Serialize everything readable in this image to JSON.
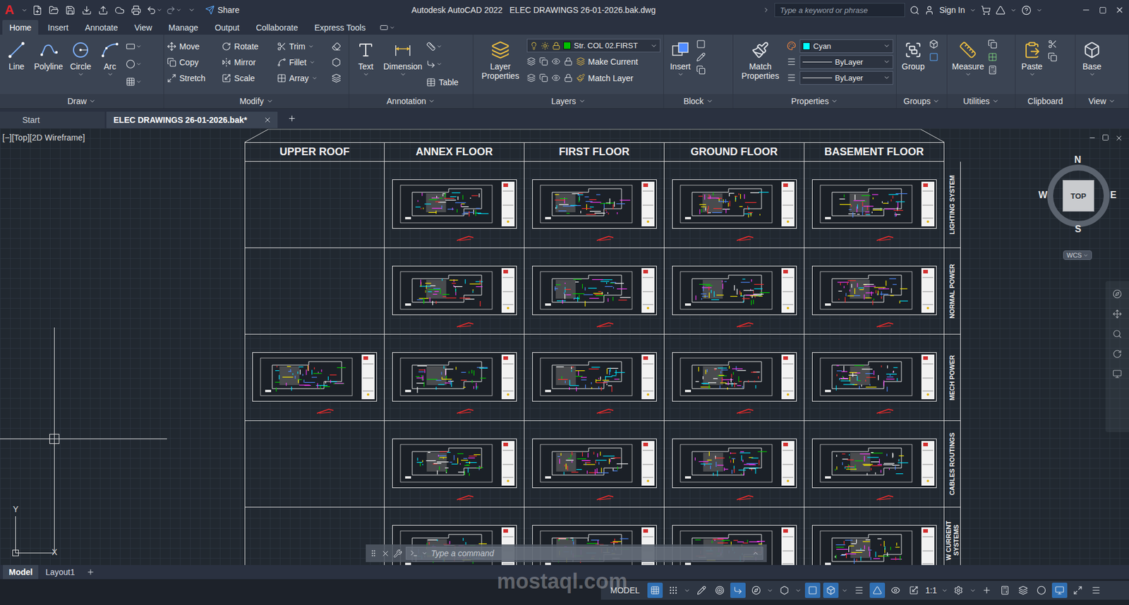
{
  "window": {
    "app_logo": "A",
    "title": "Autodesk AutoCAD 2022",
    "file": "ELEC DRAWINGS 26-01-2026.bak.dwg"
  },
  "quick_access": {
    "share": "Share"
  },
  "search": {
    "placeholder": "Type a keyword or phrase"
  },
  "account": {
    "sign_in": "Sign In"
  },
  "ribbon_tabs": [
    {
      "label": "Home",
      "selected": true
    },
    {
      "label": "Insert",
      "selected": false
    },
    {
      "label": "Annotate",
      "selected": false
    },
    {
      "label": "View",
      "selected": false
    },
    {
      "label": "Manage",
      "selected": false
    },
    {
      "label": "Output",
      "selected": false
    },
    {
      "label": "Collaborate",
      "selected": false
    },
    {
      "label": "Express Tools",
      "selected": false
    }
  ],
  "ribbon": {
    "draw": {
      "title": "Draw",
      "tools": [
        {
          "label": "Line",
          "kind": "line",
          "menu": false
        },
        {
          "label": "Polyline",
          "kind": "polyline",
          "menu": false
        },
        {
          "label": "Circle",
          "kind": "circle",
          "menu": true
        },
        {
          "label": "Arc",
          "kind": "arc",
          "menu": true
        }
      ]
    },
    "modify": {
      "title": "Modify",
      "tools": [
        {
          "label": "Move",
          "kind": "move",
          "menu": false
        },
        {
          "label": "Rotate",
          "kind": "rotate",
          "menu": false
        },
        {
          "label": "Trim",
          "kind": "trim",
          "menu": true
        },
        {
          "label": "Copy",
          "kind": "copy",
          "menu": false
        },
        {
          "label": "Mirror",
          "kind": "mirror",
          "menu": false
        },
        {
          "label": "Fillet",
          "kind": "fillet",
          "menu": true
        },
        {
          "label": "Stretch",
          "kind": "stretch",
          "menu": false
        },
        {
          "label": "Scale",
          "kind": "scale",
          "menu": false
        },
        {
          "label": "Array",
          "kind": "array",
          "menu": true
        }
      ]
    },
    "annotation": {
      "title": "Annotation",
      "tools": [
        {
          "label": "Text",
          "kind": "text",
          "menu": true
        },
        {
          "label": "Dimension",
          "kind": "dimension",
          "menu": true
        }
      ],
      "table": "Table"
    },
    "layers": {
      "title": "Layers",
      "properties": "Layer Properties",
      "current_layer": {
        "label": "Str. COL 02.FIRST",
        "color": "#00c000"
      },
      "actions": [
        "Make Current",
        "Match Layer"
      ]
    },
    "block": {
      "title": "Block",
      "insert": "Insert"
    },
    "properties": {
      "title": "Properties",
      "match": "Match Properties",
      "color": {
        "label": "Cyan",
        "color": "#00ffff"
      },
      "linetype": "ByLayer",
      "lineweight": "ByLayer"
    },
    "groups": {
      "title": "Groups",
      "tool": "Group"
    },
    "utilities": {
      "title": "Utilities",
      "tool": "Measure"
    },
    "clipboard": {
      "title": "Clipboard",
      "tool": "Paste"
    },
    "view": {
      "title": "View",
      "tool": "Base"
    }
  },
  "file_tabs": [
    {
      "label": "Start",
      "selected": false,
      "closable": false
    },
    {
      "label": "ELEC DRAWINGS 26-01-2026.bak*",
      "selected": true,
      "closable": true
    }
  ],
  "viewport": {
    "label": "[−][Top][2D Wireframe]",
    "viewcube": {
      "north": "N",
      "south": "S",
      "east": "E",
      "west": "W",
      "face": "TOP",
      "ucs": "WCS"
    },
    "ucs_icon": {
      "y": "Y",
      "x": "X"
    }
  },
  "sheet_index": {
    "columns": [
      "UPPER ROOF",
      "ANNEX FLOOR",
      "FIRST FLOOR",
      "GROUND FLOOR",
      "BASEMENT FLOOR"
    ],
    "rows": [
      {
        "label": "LIGHTING SYSTEM",
        "sheets": [
          false,
          true,
          true,
          true,
          true
        ]
      },
      {
        "label": "NORMAL POWER",
        "sheets": [
          false,
          true,
          true,
          true,
          true
        ]
      },
      {
        "label": "MECH POWER",
        "sheets": [
          true,
          true,
          true,
          true,
          true
        ]
      },
      {
        "label": "CABLES ROUTINGS",
        "sheets": [
          false,
          true,
          true,
          true,
          true
        ]
      },
      {
        "label": "W CURRENT SYSTEMS",
        "sheets": [
          false,
          true,
          true,
          true,
          true
        ]
      }
    ]
  },
  "command_line": {
    "placeholder": "Type a command"
  },
  "layout_tabs": [
    {
      "label": "Model",
      "selected": true
    },
    {
      "label": "Layout1",
      "selected": false
    }
  ],
  "status_bar": {
    "mode": "MODEL",
    "scale": "1:1",
    "left_toggles": [
      {
        "kind": "grid",
        "on": true
      },
      {
        "kind": "snap",
        "on": false
      },
      {
        "kind": "menu",
        "on": false
      },
      {
        "kind": "infer",
        "on": false
      },
      {
        "kind": "dynamic",
        "on": false
      },
      {
        "kind": "ortho",
        "on": true
      },
      {
        "kind": "polar",
        "on": false
      },
      {
        "kind": "menu",
        "on": false
      },
      {
        "kind": "isodraft",
        "on": false
      },
      {
        "kind": "menu",
        "on": false
      },
      {
        "kind": "osnap",
        "on": true
      },
      {
        "kind": "osnap3d",
        "on": true
      },
      {
        "kind": "menu",
        "on": false
      },
      {
        "kind": "lineweight",
        "on": false
      },
      {
        "kind": "annomonitor",
        "on": true
      },
      {
        "kind": "annovisible",
        "on": false
      },
      {
        "kind": "autoscale",
        "on": false
      }
    ],
    "right_toggles": [
      {
        "kind": "menu",
        "on": false
      },
      {
        "kind": "settings",
        "on": false
      },
      {
        "kind": "menu",
        "on": false
      },
      {
        "kind": "add",
        "on": false
      },
      {
        "kind": "units",
        "on": false
      },
      {
        "kind": "quickprops",
        "on": false
      },
      {
        "kind": "isolate",
        "on": false
      },
      {
        "kind": "hardware",
        "on": true
      },
      {
        "kind": "clean",
        "on": false
      },
      {
        "kind": "customize",
        "on": false
      }
    ]
  },
  "watermark": "mostaql.com"
}
